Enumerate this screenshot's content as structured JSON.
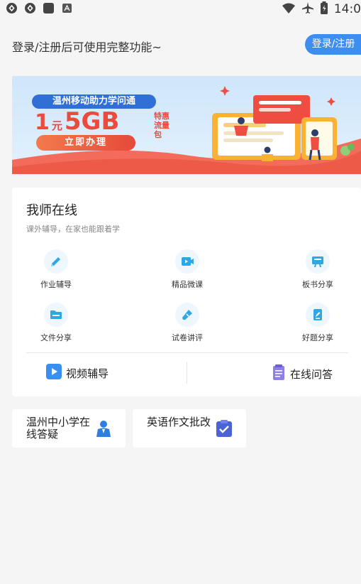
{
  "status_bar": {
    "time": "14:0",
    "left_icons": [
      "sync-icon",
      "sync-icon",
      "app-icon",
      "notification-icon"
    ],
    "right_icons": [
      "wifi-icon",
      "airplane-icon",
      "battery-icon"
    ]
  },
  "header": {
    "login_hint": "登录/注册后可使用完整功能~",
    "login_button": "登录/注册"
  },
  "banner": {
    "title": "温州移动助力学问通",
    "price_num": "1",
    "price_unit": "元",
    "price_data": "5GB",
    "promo": "特惠流量包",
    "cta": "立即办理"
  },
  "online_teacher": {
    "title": "我师在线",
    "subtitle": "课外辅导，在家也能跟着学",
    "items": [
      {
        "label": "作业辅导",
        "icon": "pencil-icon"
      },
      {
        "label": "精品微课",
        "icon": "video-icon"
      },
      {
        "label": "板书分享",
        "icon": "board-icon"
      },
      {
        "label": "文件分享",
        "icon": "folder-icon"
      },
      {
        "label": "试卷讲评",
        "icon": "pen-icon"
      },
      {
        "label": "好题分享",
        "icon": "edit-icon"
      }
    ],
    "video_tutoring": "视频辅导",
    "online_qa": "在线问答"
  },
  "tiles": [
    {
      "label": "温州中小学在线答疑",
      "icon": "teacher-icon"
    },
    {
      "label": "英语作文批改",
      "icon": "clipboard-check-icon"
    }
  ],
  "colors": {
    "accent": "#3d8ef0",
    "icon_blue": "#2fa7e6",
    "banner_red": "#ea4b3c"
  }
}
